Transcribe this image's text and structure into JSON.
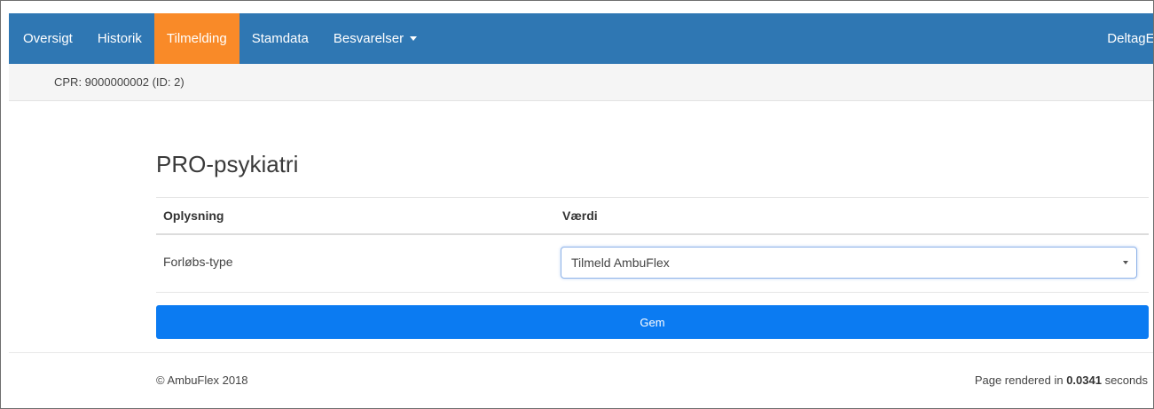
{
  "nav": {
    "items": [
      {
        "label": "Oversigt",
        "active": false
      },
      {
        "label": "Historik",
        "active": false
      },
      {
        "label": "Tilmelding",
        "active": true
      },
      {
        "label": "Stamdata",
        "active": false
      },
      {
        "label": "Besvarelser",
        "active": false,
        "dropdown": true
      }
    ],
    "right_label": "DeltagEd",
    "colors": {
      "bar": "#2f77b3",
      "active": "#f98a28"
    }
  },
  "patient": {
    "cpr_text": "CPR: 9000000002 (ID: 2)"
  },
  "form": {
    "title": "PRO-psykiatri",
    "columns": [
      "Oplysning",
      "Værdi"
    ],
    "rows": [
      {
        "label": "Forløbs-type",
        "value": "Tilmeld AmbuFlex"
      }
    ],
    "submit_label": "Gem",
    "submit_color": "#0b7bf2"
  },
  "footer": {
    "copyright": "© AmbuFlex 2018",
    "render_prefix": "Page rendered in ",
    "render_time": "0.0341",
    "render_suffix": " seconds"
  }
}
